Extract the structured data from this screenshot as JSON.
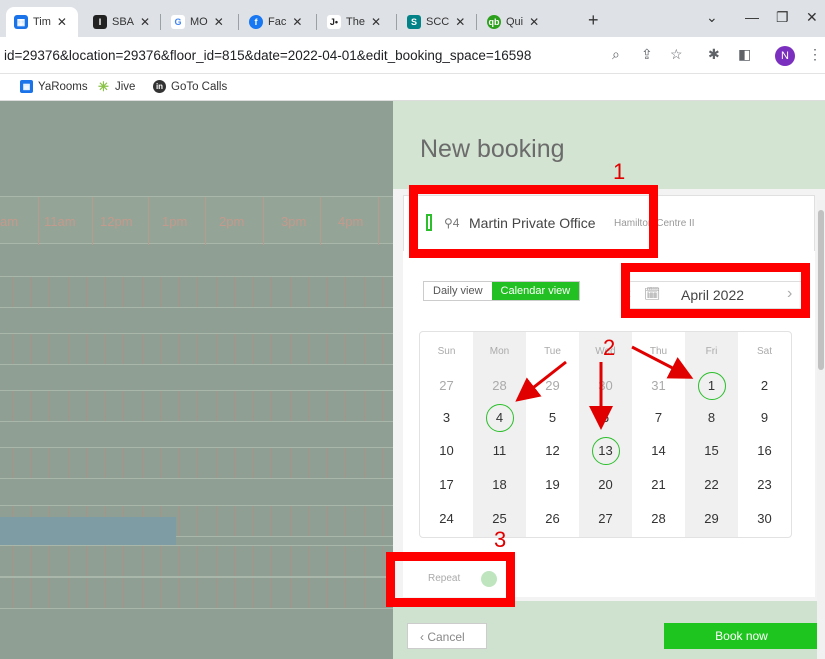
{
  "browser": {
    "tabs": [
      {
        "label": "Tim",
        "icon": "yarooms-icon",
        "color": "#1a73e8",
        "active": true
      },
      {
        "label": "SBA",
        "icon": "sba-icon",
        "color": "#222222"
      },
      {
        "label": "MO",
        "icon": "google-icon",
        "color": "#4285f4"
      },
      {
        "label": "Fac",
        "icon": "facebook-icon",
        "color": "#1877f2"
      },
      {
        "label": "The",
        "icon": "jive-icon",
        "color": "#222222"
      },
      {
        "label": "SCC",
        "icon": "sharepoint-icon",
        "color": "#038387"
      },
      {
        "label": "Qui",
        "icon": "quickbooks-icon",
        "color": "#2ca01c"
      }
    ],
    "url": "id=29376&location=29376&floor_id=815&date=2022-04-01&edit_booking_space=16598",
    "profile_initial": "N",
    "bookmarks": [
      {
        "label": "YaRooms",
        "icon": "yarooms-icon",
        "color": "#1a73e8"
      },
      {
        "label": "Jive",
        "icon": "jive-icon",
        "color": "#8bc34a"
      },
      {
        "label": "GoTo Calls",
        "icon": "goto-icon",
        "color": "#333333"
      }
    ]
  },
  "schedule": {
    "hours": [
      "am",
      "11am",
      "12pm",
      "1pm",
      "2pm",
      "3pm",
      "4pm"
    ]
  },
  "booking": {
    "title": "New booking",
    "space": {
      "capacity": "4",
      "name": "Martin Private Office",
      "location": "Hamilton Centre II"
    },
    "views": {
      "daily": "Daily view",
      "calendar": "Calendar view"
    },
    "month_label": "April 2022",
    "weekdays": [
      "Sun",
      "Mon",
      "Tue",
      "Wed",
      "Thu",
      "Fri",
      "Sat"
    ],
    "weeks": [
      [
        "27",
        "28",
        "29",
        "30",
        "31",
        "1",
        "2"
      ],
      [
        "3",
        "4",
        "5",
        "6",
        "7",
        "8",
        "9"
      ],
      [
        "10",
        "11",
        "12",
        "13",
        "14",
        "15",
        "16"
      ],
      [
        "17",
        "18",
        "19",
        "20",
        "21",
        "22",
        "23"
      ],
      [
        "24",
        "25",
        "26",
        "27",
        "28",
        "29",
        "30"
      ]
    ],
    "repeat_label": "Repeat",
    "cancel_label": "Cancel",
    "book_label": "Book now"
  },
  "annotations": [
    "1",
    "2",
    "3"
  ],
  "colors": {
    "accent": "#22c022",
    "annotation": "#ff0000"
  }
}
